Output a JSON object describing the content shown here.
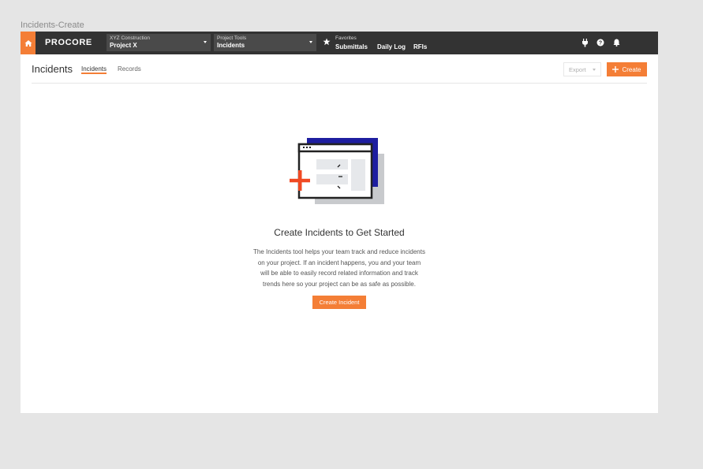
{
  "frame": {
    "label": "Incidents-Create"
  },
  "topnav": {
    "logo": "PROCORE",
    "project_picker": {
      "company": "XYZ Construction",
      "project": "Project X"
    },
    "tool_picker": {
      "label": "Project Tools",
      "tool": "Incidents"
    },
    "favorites": {
      "label": "Favorites",
      "items": [
        "Submittals",
        "Daily Log",
        "RFIs"
      ]
    },
    "icons": [
      "plug-icon",
      "help-icon",
      "bell-icon"
    ]
  },
  "header": {
    "title": "Incidents",
    "tabs": [
      {
        "label": "Incidents",
        "active": true
      },
      {
        "label": "Records",
        "active": false
      }
    ],
    "export_label": "Export",
    "create_label": "Create"
  },
  "empty_state": {
    "title": "Create Incidents to Get Started",
    "description_lines": [
      "The Incidents tool helps your team track and reduce incidents",
      "on your project. If an incident happens, you and your team",
      "will be able to easily record related information and track",
      "trends here so your project can be as safe as possible."
    ],
    "cta_label": "Create Incident"
  },
  "colors": {
    "accent": "#f47e36",
    "nav_bg": "#333333",
    "illustration_blue": "#1e1ea0",
    "illustration_red": "#f04a23"
  }
}
